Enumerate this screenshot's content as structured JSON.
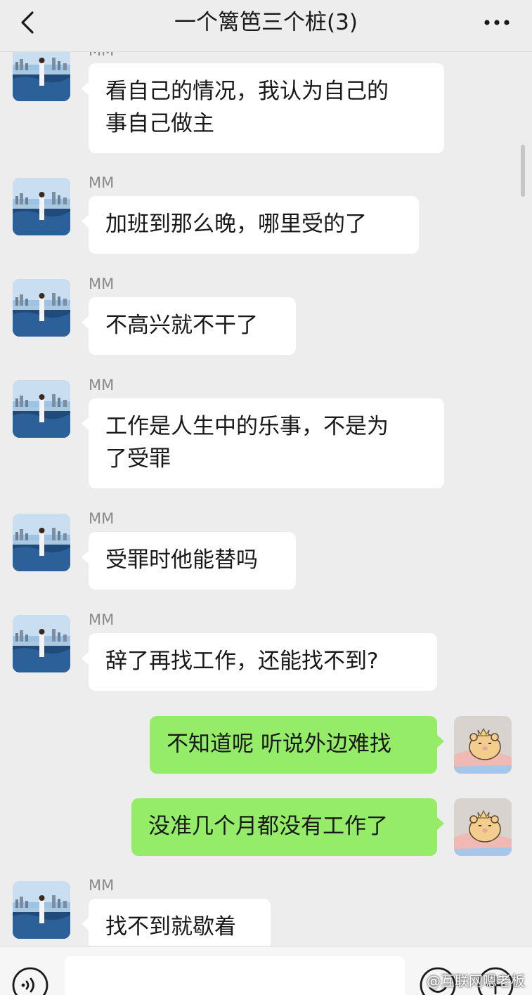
{
  "header": {
    "title": "一个篱笆三个桩(3)"
  },
  "messages": [
    {
      "sender": "MM",
      "text": "看自己的情况，我认为自己的\n事自己做主"
    },
    {
      "sender": "MM",
      "text": "加班到那么晚，哪里受的了"
    },
    {
      "sender": "MM",
      "text": "不高兴就不干了"
    },
    {
      "sender": "MM",
      "text": "工作是人生中的乐事，不是为\n了受罪"
    },
    {
      "sender": "MM",
      "text": "受罪时他能替吗"
    },
    {
      "sender": "MM",
      "text": "辞了再找工作，还能找不到?"
    },
    {
      "sender": "",
      "text": "不知道呢 听说外边难找"
    },
    {
      "sender": "",
      "text": "没准几个月都没有工作了"
    },
    {
      "sender": "MM",
      "text": "找不到就歇着"
    }
  ],
  "watermark": "@互联网嗯老板",
  "colors": {
    "outgoing": "#95ec69",
    "incoming": "#ffffff",
    "background": "#ededed"
  },
  "icons": {
    "back": "chevron-left-icon",
    "more": "ellipsis-icon",
    "voice": "voice-icon",
    "emoji": "emoji-icon",
    "plus": "plus-icon"
  }
}
